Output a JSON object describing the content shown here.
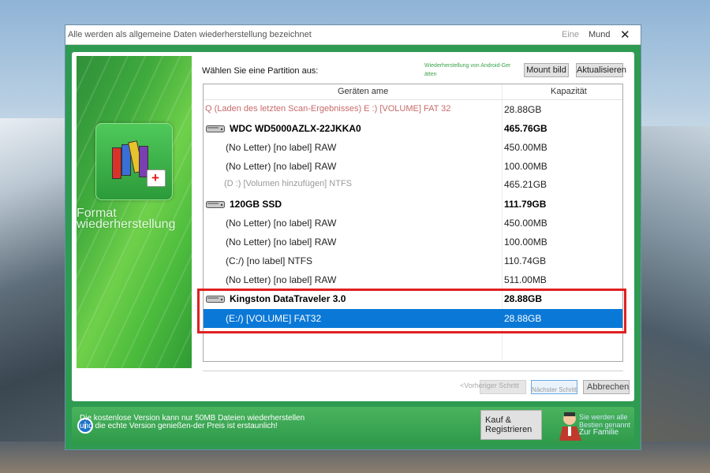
{
  "window": {
    "title": "Alle werden als allgemeine Daten wiederherstellung bezeichnet",
    "min_label": "Eine",
    "max_label": "Mund",
    "close_label": "✕"
  },
  "banner": {
    "title": "Format wiederherstellung"
  },
  "partition": {
    "choose_label": "Wählen Sie eine Partition aus:",
    "android_link": "Wiederherstellung von Android-Ger ätten",
    "mount_button": "Mount bild",
    "refresh_button": "Aktualisieren"
  },
  "table": {
    "col_name": "Geräten ame",
    "col_capacity": "Kapazität",
    "rows": [
      {
        "name": "Q (Laden des letzten Scan-Ergebnisses) E :) [VOLUME] FAT 32",
        "capacity": "28.88GB"
      },
      {
        "name": "WDC WD5000AZLX-22JKKA0",
        "capacity": "465.76GB"
      },
      {
        "name": "(No Letter) [no label] RAW",
        "capacity": "450.00MB"
      },
      {
        "name": "(No Letter) [no label] RAW",
        "capacity": "100.00MB"
      },
      {
        "name": "(D :) [Volumen hinzufügen] NTFS",
        "capacity": "465.21GB"
      },
      {
        "name": "120GB SSD",
        "capacity": "111.79GB"
      },
      {
        "name": "(No Letter) [no label] RAW",
        "capacity": "450.00MB"
      },
      {
        "name": "(No Letter) [no label] RAW",
        "capacity": "100.00MB"
      },
      {
        "name": "(C:/) [no label] NTFS",
        "capacity": "110.74GB"
      },
      {
        "name": "(No Letter) [no label] RAW",
        "capacity": "511.00MB"
      },
      {
        "name": "Kingston DataTraveler 3.0",
        "capacity": "28.88GB"
      },
      {
        "name": "(E:/) [VOLUME] FAT32",
        "capacity": "28.88GB"
      }
    ]
  },
  "nav": {
    "prev": "<Vorheriger Schritt",
    "next": "Nächster Schritt",
    "cancel": "Abbrechen"
  },
  "footer": {
    "line1": "Die kostenlose Version kann nur 50MB Dateien wiederherstellen",
    "line2": "und die echte Version genießen-der Preis ist erstaunlich!",
    "buy_button": "Kauf & Registrieren",
    "tag_line1": "Sie werden alle",
    "tag_line2": "Bestien genannt",
    "tag_line3": "Zur Familie"
  },
  "colors": {
    "accent_green": "#2e9a52",
    "selection_blue": "#0a78d7",
    "highlight_red": "#e02020"
  }
}
